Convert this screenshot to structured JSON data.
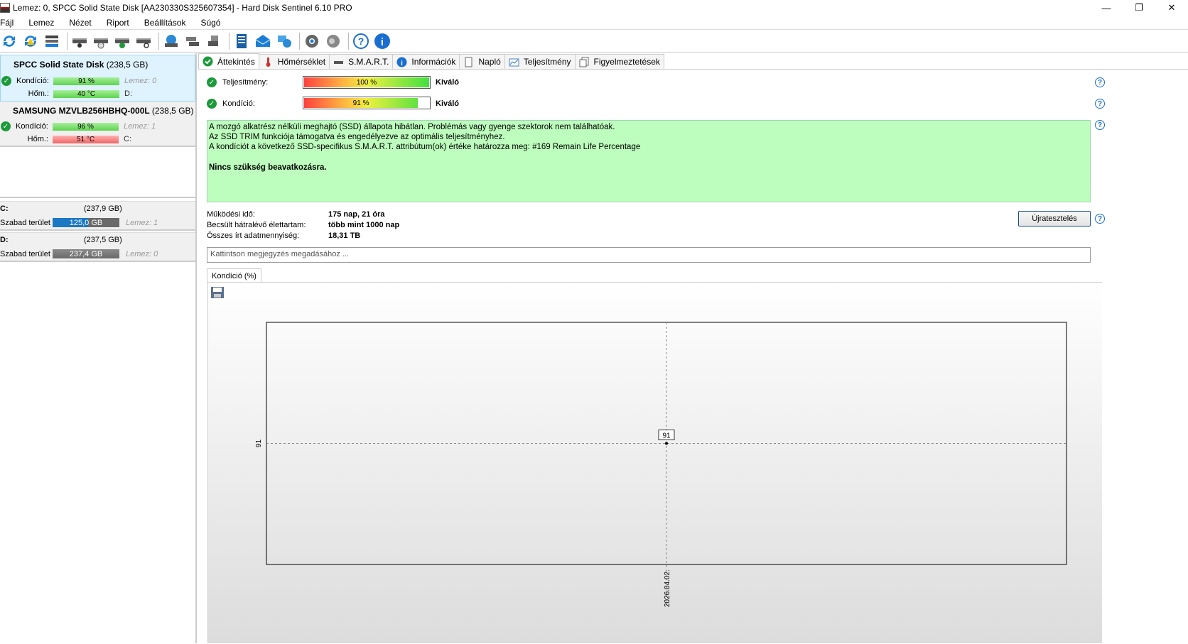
{
  "window": {
    "title": "Lemez: 0, SPCC Solid State Disk [AA230330S325607354]  -  Hard Disk Sentinel 6.10 PRO",
    "minimize": "—",
    "maximize": "❐",
    "close": "✕"
  },
  "menu": [
    "Fájl",
    "Lemez",
    "Nézet",
    "Riport",
    "Beállítások",
    "Súgó"
  ],
  "toolbar_icons": [
    "refresh-icon",
    "refresh-warning-icon",
    "disk-list-icon",
    "disk-icon",
    "disk-clock-icon",
    "disk-check-icon",
    "disk-search-icon",
    "globe-disk-icon",
    "network-disk-icon",
    "usb-disk-icon",
    "report-icon",
    "email-icon",
    "network-icon",
    "settings-icon",
    "sound-icon",
    "help-icon",
    "info-icon"
  ],
  "disks": [
    {
      "name": "SPCC Solid State Disk",
      "size": "(238,5 GB)",
      "health_label": "Kondíció:",
      "health": "91 %",
      "temp_label": "Hőm.:",
      "temp": "40 °C",
      "disk_index": "Lemez: 0",
      "drive": "D:"
    },
    {
      "name": "SAMSUNG MZVLB256HBHQ-000L",
      "size": "(238,5 GB)",
      "health_label": "Kondíció:",
      "health": "96 %",
      "temp_label": "Hőm.:",
      "temp": "51 °C",
      "disk_index": "Lemez: 1",
      "drive": "C:"
    }
  ],
  "volumes": [
    {
      "name": "C:",
      "size": "(237,9 GB)",
      "free_label": "Szabad terület",
      "free": "125,0 GB",
      "free_fraction": 0.53,
      "disk": "Lemez: 1"
    },
    {
      "name": "D:",
      "size": "(237,5 GB)",
      "free_label": "Szabad terület",
      "free": "237,4 GB",
      "free_fraction": 1.0,
      "disk": "Lemez: 0"
    }
  ],
  "tabs": [
    "Áttekintés",
    "Hőmérséklet",
    "S.M.A.R.T.",
    "Információk",
    "Napló",
    "Teljesítmény",
    "Figyelmeztetések"
  ],
  "overview": {
    "performance_label": "Teljesítmény:",
    "performance": "100 %",
    "performance_value": 100,
    "performance_result": "Kiváló",
    "health_label": "Kondíció:",
    "health": "91 %",
    "health_value": 91,
    "health_result": "Kiváló",
    "info_lines": [
      "A mozgó alkatrész nélküli meghajtó (SSD) állapota hibátlan. Problémás vagy gyenge szektorok nem találhatóak.",
      "Az SSD TRIM funkciója támogatva és engedélyezve az optimális teljesítményhez.",
      "A kondíciót a következő SSD-specifikus S.M.A.R.T. attribútum(ok) értéke határozza meg:  #169 Remain Life Percentage"
    ],
    "info_action": "Nincs szükség beavatkozásra.",
    "stats": [
      {
        "label": "Működési idő:",
        "value": "175 nap, 21 óra"
      },
      {
        "label": "Becsült hátralévő élettartam:",
        "value": "több mint 1000 nap"
      },
      {
        "label": "Összes írt adatmennyiség:",
        "value": "18,31 TB"
      }
    ],
    "retest_label": "Újratesztelés",
    "note_placeholder": "Kattintson megjegyzés megadásához ...",
    "chart_tab": "Kondíció  (%)"
  },
  "chart_data": {
    "type": "line",
    "x": [
      "2026.04.02."
    ],
    "series": [
      {
        "values": [
          91
        ]
      }
    ],
    "y_ticks": [
      "91"
    ],
    "point_label": "91"
  }
}
